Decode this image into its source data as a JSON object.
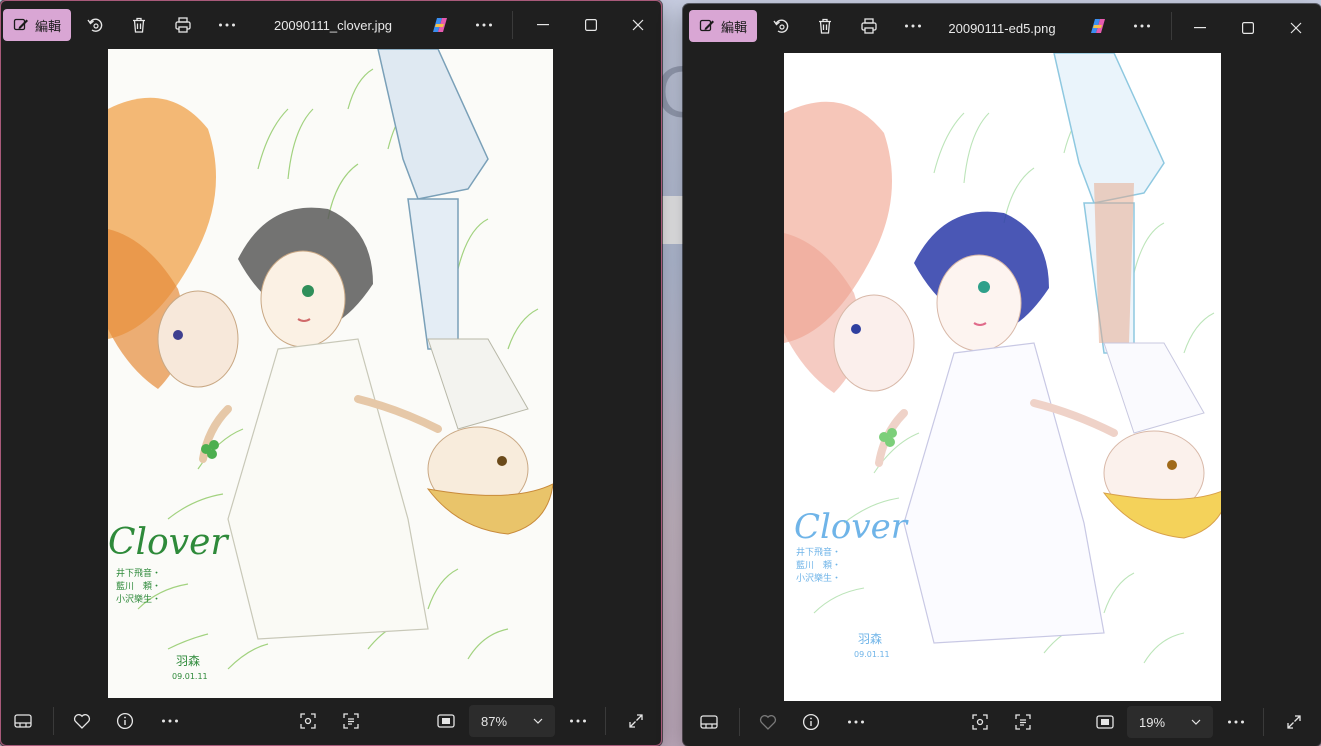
{
  "windows": [
    {
      "edit_label": "編輯",
      "filename": "20090111_clover.jpg",
      "zoom": "87%",
      "artwork": {
        "title": "Clover",
        "credits": [
          "井下飛音・",
          "藍川　頼・",
          "小沢樂生・"
        ],
        "signature": "羽森",
        "date": "09.01.11"
      }
    },
    {
      "edit_label": "編輯",
      "filename": "20090111-ed5.png",
      "zoom": "19%",
      "artwork": {
        "title": "Clover",
        "credits": [
          "井下飛音・",
          "藍川　頼・",
          "小沢樂生・"
        ],
        "signature": "羽森",
        "date": "09.01.11"
      }
    }
  ],
  "desktop": {
    "text": "G"
  },
  "colors": {
    "accent": "#d9a6d4",
    "window_bg": "#1f1f1f",
    "border_active": "#a85a7a"
  }
}
